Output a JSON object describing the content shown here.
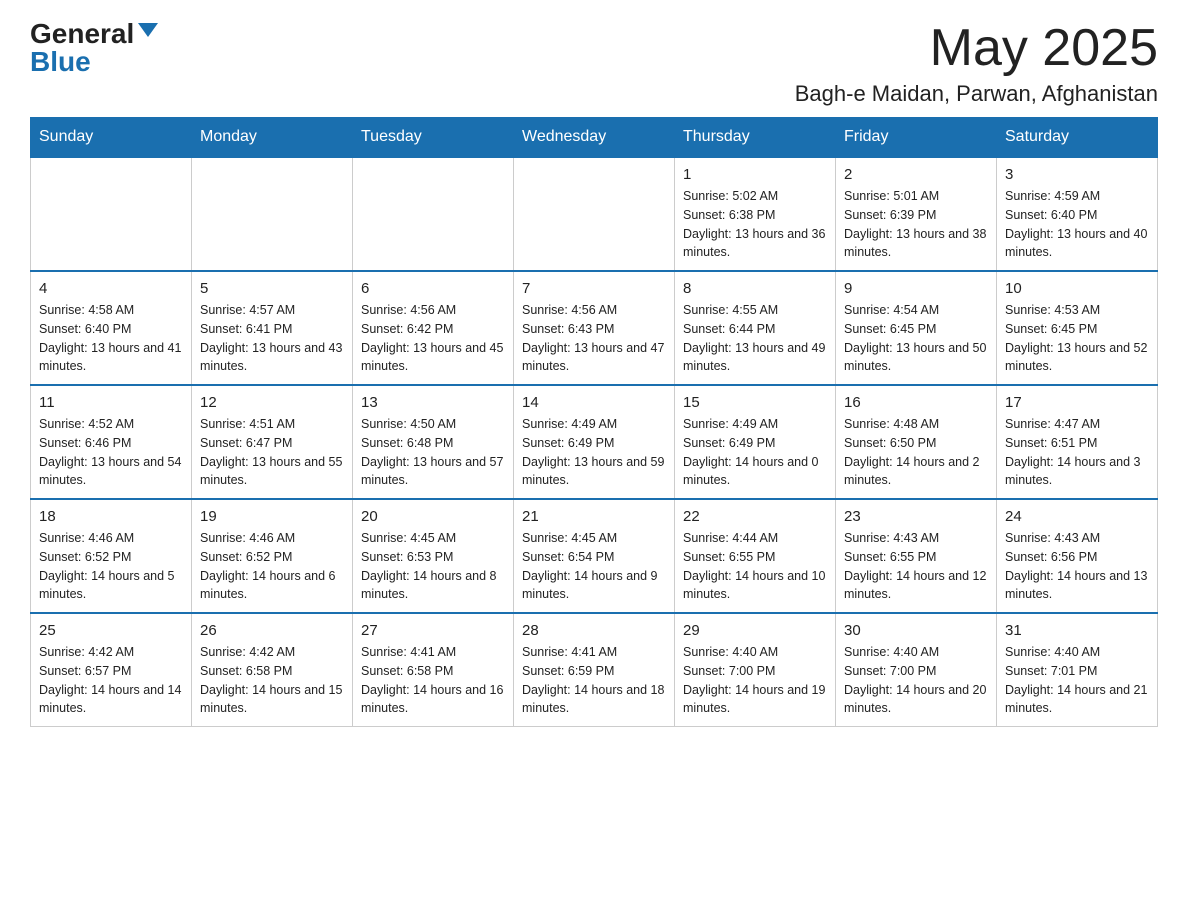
{
  "header": {
    "logo_general": "General",
    "logo_blue": "Blue",
    "month_title": "May 2025",
    "location": "Bagh-e Maidan, Parwan, Afghanistan"
  },
  "days_of_week": [
    "Sunday",
    "Monday",
    "Tuesday",
    "Wednesday",
    "Thursday",
    "Friday",
    "Saturday"
  ],
  "weeks": [
    [
      {
        "day": "",
        "info": ""
      },
      {
        "day": "",
        "info": ""
      },
      {
        "day": "",
        "info": ""
      },
      {
        "day": "",
        "info": ""
      },
      {
        "day": "1",
        "info": "Sunrise: 5:02 AM\nSunset: 6:38 PM\nDaylight: 13 hours and 36 minutes."
      },
      {
        "day": "2",
        "info": "Sunrise: 5:01 AM\nSunset: 6:39 PM\nDaylight: 13 hours and 38 minutes."
      },
      {
        "day": "3",
        "info": "Sunrise: 4:59 AM\nSunset: 6:40 PM\nDaylight: 13 hours and 40 minutes."
      }
    ],
    [
      {
        "day": "4",
        "info": "Sunrise: 4:58 AM\nSunset: 6:40 PM\nDaylight: 13 hours and 41 minutes."
      },
      {
        "day": "5",
        "info": "Sunrise: 4:57 AM\nSunset: 6:41 PM\nDaylight: 13 hours and 43 minutes."
      },
      {
        "day": "6",
        "info": "Sunrise: 4:56 AM\nSunset: 6:42 PM\nDaylight: 13 hours and 45 minutes."
      },
      {
        "day": "7",
        "info": "Sunrise: 4:56 AM\nSunset: 6:43 PM\nDaylight: 13 hours and 47 minutes."
      },
      {
        "day": "8",
        "info": "Sunrise: 4:55 AM\nSunset: 6:44 PM\nDaylight: 13 hours and 49 minutes."
      },
      {
        "day": "9",
        "info": "Sunrise: 4:54 AM\nSunset: 6:45 PM\nDaylight: 13 hours and 50 minutes."
      },
      {
        "day": "10",
        "info": "Sunrise: 4:53 AM\nSunset: 6:45 PM\nDaylight: 13 hours and 52 minutes."
      }
    ],
    [
      {
        "day": "11",
        "info": "Sunrise: 4:52 AM\nSunset: 6:46 PM\nDaylight: 13 hours and 54 minutes."
      },
      {
        "day": "12",
        "info": "Sunrise: 4:51 AM\nSunset: 6:47 PM\nDaylight: 13 hours and 55 minutes."
      },
      {
        "day": "13",
        "info": "Sunrise: 4:50 AM\nSunset: 6:48 PM\nDaylight: 13 hours and 57 minutes."
      },
      {
        "day": "14",
        "info": "Sunrise: 4:49 AM\nSunset: 6:49 PM\nDaylight: 13 hours and 59 minutes."
      },
      {
        "day": "15",
        "info": "Sunrise: 4:49 AM\nSunset: 6:49 PM\nDaylight: 14 hours and 0 minutes."
      },
      {
        "day": "16",
        "info": "Sunrise: 4:48 AM\nSunset: 6:50 PM\nDaylight: 14 hours and 2 minutes."
      },
      {
        "day": "17",
        "info": "Sunrise: 4:47 AM\nSunset: 6:51 PM\nDaylight: 14 hours and 3 minutes."
      }
    ],
    [
      {
        "day": "18",
        "info": "Sunrise: 4:46 AM\nSunset: 6:52 PM\nDaylight: 14 hours and 5 minutes."
      },
      {
        "day": "19",
        "info": "Sunrise: 4:46 AM\nSunset: 6:52 PM\nDaylight: 14 hours and 6 minutes."
      },
      {
        "day": "20",
        "info": "Sunrise: 4:45 AM\nSunset: 6:53 PM\nDaylight: 14 hours and 8 minutes."
      },
      {
        "day": "21",
        "info": "Sunrise: 4:45 AM\nSunset: 6:54 PM\nDaylight: 14 hours and 9 minutes."
      },
      {
        "day": "22",
        "info": "Sunrise: 4:44 AM\nSunset: 6:55 PM\nDaylight: 14 hours and 10 minutes."
      },
      {
        "day": "23",
        "info": "Sunrise: 4:43 AM\nSunset: 6:55 PM\nDaylight: 14 hours and 12 minutes."
      },
      {
        "day": "24",
        "info": "Sunrise: 4:43 AM\nSunset: 6:56 PM\nDaylight: 14 hours and 13 minutes."
      }
    ],
    [
      {
        "day": "25",
        "info": "Sunrise: 4:42 AM\nSunset: 6:57 PM\nDaylight: 14 hours and 14 minutes."
      },
      {
        "day": "26",
        "info": "Sunrise: 4:42 AM\nSunset: 6:58 PM\nDaylight: 14 hours and 15 minutes."
      },
      {
        "day": "27",
        "info": "Sunrise: 4:41 AM\nSunset: 6:58 PM\nDaylight: 14 hours and 16 minutes."
      },
      {
        "day": "28",
        "info": "Sunrise: 4:41 AM\nSunset: 6:59 PM\nDaylight: 14 hours and 18 minutes."
      },
      {
        "day": "29",
        "info": "Sunrise: 4:40 AM\nSunset: 7:00 PM\nDaylight: 14 hours and 19 minutes."
      },
      {
        "day": "30",
        "info": "Sunrise: 4:40 AM\nSunset: 7:00 PM\nDaylight: 14 hours and 20 minutes."
      },
      {
        "day": "31",
        "info": "Sunrise: 4:40 AM\nSunset: 7:01 PM\nDaylight: 14 hours and 21 minutes."
      }
    ]
  ]
}
